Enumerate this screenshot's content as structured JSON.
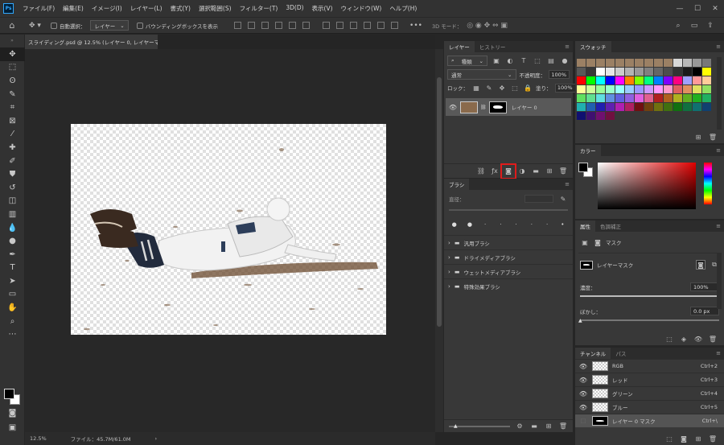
{
  "app": {
    "logo": "Ps"
  },
  "menu": [
    "ファイル(F)",
    "編集(E)",
    "イメージ(I)",
    "レイヤー(L)",
    "書式(Y)",
    "選択範囲(S)",
    "フィルター(T)",
    "3D(D)",
    "表示(V)",
    "ウィンドウ(W)",
    "ヘルプ(H)"
  ],
  "options": {
    "auto_select": "自動選択：",
    "target": "レイヤー",
    "bounding": "バウンディングボックスを表示",
    "mode3d": "3D モード："
  },
  "document": {
    "tab_title": "スライディング.psd @ 12.5% (レイヤー 0, レイヤーマスク/8) *",
    "zoom": "12.5%",
    "file_info": "ファイル：45.7M/61.0M"
  },
  "layers_panel": {
    "tabs": [
      "レイヤー",
      "ヒストリー"
    ],
    "filter": "種類",
    "blend_mode": "通常",
    "opacity_label": "不透明度：",
    "opacity": "100%",
    "lock_label": "ロック：",
    "fill_label": "塗り：",
    "fill": "100%",
    "layer_name": "レイヤー 0"
  },
  "brush_panel": {
    "tab": "ブラシ",
    "size_label": "直径：",
    "folders": [
      "汎用ブラシ",
      "ドライメディアブラシ",
      "ウェットメディアブラシ",
      "特殊効果ブラシ"
    ]
  },
  "swatches_panel": {
    "tab": "スウォッチ",
    "colors": [
      "#9b8064",
      "#9b8064",
      "#9b8064",
      "#9b8064",
      "#9b8064",
      "#9b8064",
      "#9b8064",
      "#9b8064",
      "#9b8064",
      "#9b8064",
      "#d8d8d8",
      "#b8b8b8",
      "#989898",
      "#787878",
      "#585858",
      "#383838",
      "#ffffff",
      "#e6e6e6",
      "#cccccc",
      "#b3b3b3",
      "#999999",
      "#808080",
      "#666666",
      "#4d4d4d",
      "#333333",
      "#1a1a1a",
      "#000000",
      "#ffff00",
      "#ff0000",
      "#00ff00",
      "#00ffff",
      "#0000ff",
      "#ff00ff",
      "#ff8000",
      "#80ff00",
      "#00ff80",
      "#0080ff",
      "#8000ff",
      "#ff0080",
      "#a0a0ff",
      "#ff9999",
      "#ffcc99",
      "#ffff99",
      "#ccff99",
      "#99ff99",
      "#99ffcc",
      "#99ffff",
      "#99ccff",
      "#9999ff",
      "#cc99ff",
      "#ff99ff",
      "#ff99cc",
      "#e06060",
      "#e09060",
      "#e0e060",
      "#90e060",
      "#60e060",
      "#60e090",
      "#60e0e0",
      "#6090e0",
      "#6060e0",
      "#9060e0",
      "#e060e0",
      "#e06090",
      "#b02020",
      "#b06020",
      "#b0b020",
      "#60b020",
      "#20b020",
      "#20b060",
      "#20b0b0",
      "#2060b0",
      "#2020b0",
      "#6020b0",
      "#b020b0",
      "#b02060",
      "#701010",
      "#704010",
      "#707010",
      "#407010",
      "#107010",
      "#107040",
      "#107070",
      "#104070",
      "#101070",
      "#401070",
      "#701070",
      "#701040"
    ]
  },
  "color_panel": {
    "tab": "カラー"
  },
  "properties_panel": {
    "tabs": [
      "属性",
      "色調補正"
    ],
    "mode_label": "マスク",
    "mask_label": "レイヤーマスク",
    "density_label": "濃度：",
    "density": "100%",
    "feather_label": "ぼかし：",
    "feather": "0.0 px"
  },
  "channels_panel": {
    "tabs": [
      "チャンネル",
      "パス"
    ],
    "channels": [
      {
        "name": "RGB",
        "shortcut": "Ctrl+2"
      },
      {
        "name": "レッド",
        "shortcut": "Ctrl+3"
      },
      {
        "name": "グリーン",
        "shortcut": "Ctrl+4"
      },
      {
        "name": "ブルー",
        "shortcut": "Ctrl+5"
      },
      {
        "name": "レイヤー 0 マスク",
        "shortcut": "Ctrl+\\"
      }
    ]
  },
  "highlight_color": "#e01b1b"
}
